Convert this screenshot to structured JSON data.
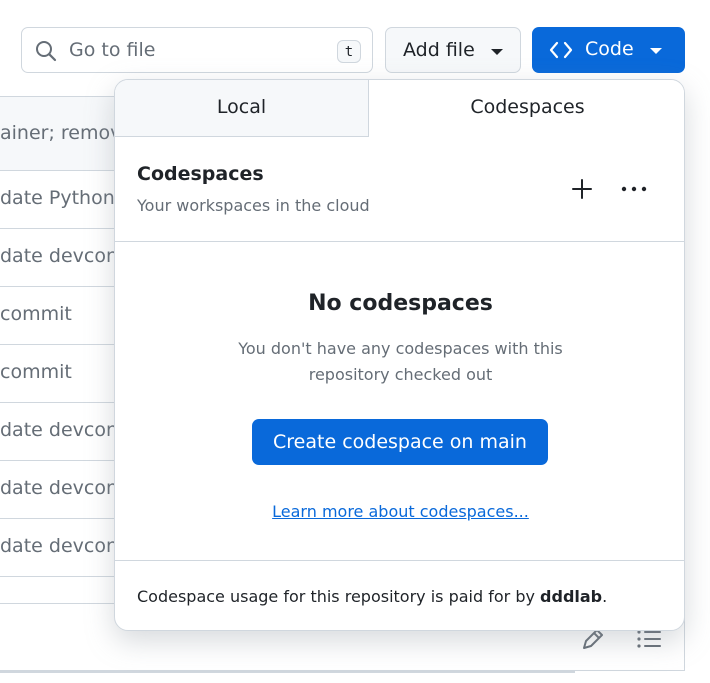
{
  "toolbar": {
    "search_placeholder": "Go to file",
    "search_shortcut": "t",
    "add_file_label": "Add file",
    "code_label": "Code"
  },
  "files": {
    "header_commit": "ainer; remov",
    "rows": [
      "date Python",
      "date devcon",
      "commit",
      "commit",
      "date devcon",
      "date devcon",
      "date devcon"
    ]
  },
  "panel": {
    "tabs": [
      "Local",
      "Codespaces"
    ],
    "active_tab": "Codespaces",
    "title": "Codespaces",
    "subtitle": "Your workspaces in the cloud",
    "empty_title": "No codespaces",
    "empty_desc": "You don't have any codespaces with this repository checked out",
    "create_button": "Create codespace on main",
    "learn_link": "Learn more about codespaces...",
    "footer_prefix": "Codespace usage for this repository is paid for by ",
    "footer_owner": "dddlab",
    "footer_suffix": "."
  },
  "icons": {
    "search": "search-icon",
    "code": "code-icon",
    "caret": "triangle-down-icon",
    "plus": "plus-icon",
    "more": "kebab-horizontal-icon",
    "pencil": "pencil-icon",
    "list": "list-unordered-icon"
  },
  "colors": {
    "accent": "#0969da",
    "border": "#d0d7de",
    "muted_text": "#656d76",
    "text": "#1f2328",
    "subtle_bg": "#f6f8fa"
  }
}
